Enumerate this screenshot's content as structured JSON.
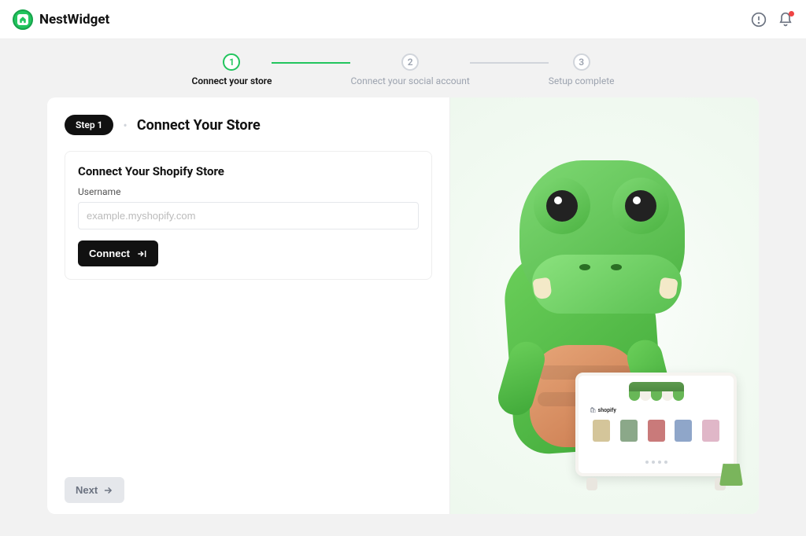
{
  "brand": {
    "name": "NestWidget"
  },
  "stepper": {
    "steps": [
      {
        "num": "1",
        "label": "Connect your store",
        "active": true
      },
      {
        "num": "2",
        "label": "Connect your social account",
        "active": false
      },
      {
        "num": "3",
        "label": "Setup complete",
        "active": false
      }
    ]
  },
  "panel": {
    "step_badge": "Step 1",
    "title": "Connect Your Store",
    "form_title": "Connect Your Shopify Store",
    "username_label": "Username",
    "username_placeholder": "example.myshopify.com",
    "username_value": "",
    "connect_btn": "Connect",
    "next_btn": "Next"
  },
  "illustration": {
    "shop_brand": "shopify"
  }
}
